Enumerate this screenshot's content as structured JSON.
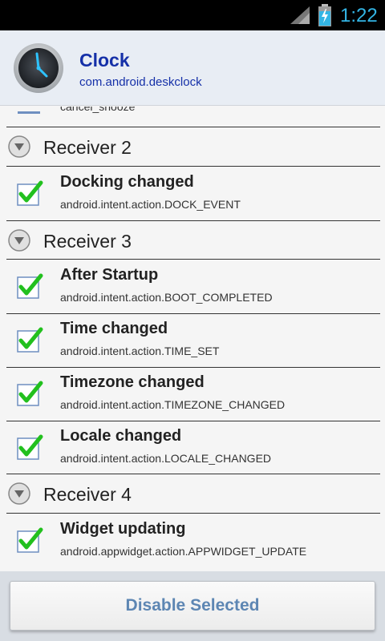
{
  "status_bar": {
    "time": "1:22",
    "accent_color": "#33b5e5"
  },
  "app": {
    "name": "Clock",
    "package": "com.android.deskclock",
    "icon": "clock-icon"
  },
  "cut_item": {
    "text": "cancel_snooze"
  },
  "groups": [
    {
      "label": "Receiver 2",
      "items": [
        {
          "title": "Docking changed",
          "action": "android.intent.action.DOCK_EVENT",
          "checked": true
        }
      ]
    },
    {
      "label": "Receiver 3",
      "items": [
        {
          "title": "After Startup",
          "action": "android.intent.action.BOOT_COMPLETED",
          "checked": true
        },
        {
          "title": "Time changed",
          "action": "android.intent.action.TIME_SET",
          "checked": true
        },
        {
          "title": "Timezone changed",
          "action": "android.intent.action.TIMEZONE_CHANGED",
          "checked": true
        },
        {
          "title": "Locale changed",
          "action": "android.intent.action.LOCALE_CHANGED",
          "checked": true
        }
      ]
    },
    {
      "label": "Receiver 4",
      "items": [
        {
          "title": "Widget updating",
          "action": "android.appwidget.action.APPWIDGET_UPDATE",
          "checked": true
        }
      ]
    }
  ],
  "bottom": {
    "button_label": "Disable Selected"
  },
  "colors": {
    "title_blue": "#1530a8",
    "button_text": "#5d86b3",
    "check_green": "#22c01e"
  }
}
